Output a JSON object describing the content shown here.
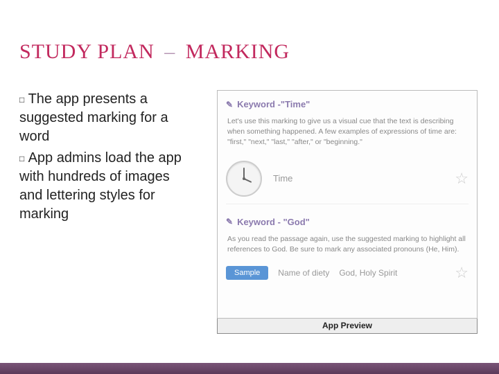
{
  "title": {
    "part1": "STUDY PLAN",
    "dash": "–",
    "part2": "MARKING"
  },
  "bullets": [
    "The app presents a suggested marking for a word",
    "App admins load the app with hundreds of images and lettering styles for marking"
  ],
  "preview": {
    "caption": "App Preview",
    "sections": [
      {
        "edit_icon": "✎",
        "heading": "Keyword -\"Time\"",
        "desc": "Let's use this marking to give us a visual cue that the text is describing when something happened. A few examples of expressions of time are: \"first,\" \"next,\" \"last,\" \"after,\" or \"beginning.\"",
        "marking_label": "Time",
        "star": "☆"
      },
      {
        "edit_icon": "✎",
        "heading": "Keyword - \"God\"",
        "desc": "As you read the passage again, use the suggested marking to highlight all references to God. Be sure to mark any associated pronouns (He, Him).",
        "sample_btn": "Sample",
        "tag1": "Name of diety",
        "tag2": "God, Holy Spirit",
        "star": "☆"
      }
    ]
  }
}
